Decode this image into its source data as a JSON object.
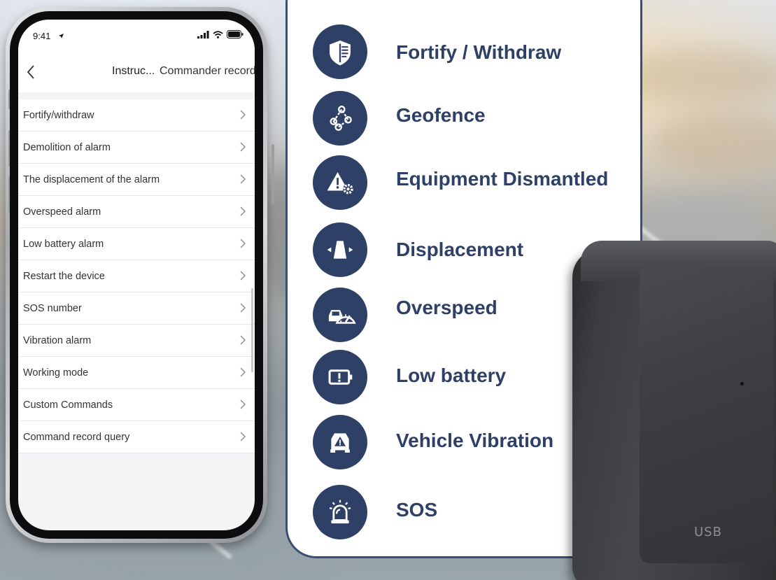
{
  "phone": {
    "status_time": "9:41",
    "title": "Instruc...",
    "right_link": "Commander record",
    "menu_items": [
      "Fortify/withdraw",
      "Demolition of alarm",
      "The displacement of the alarm",
      "Overspeed alarm",
      "Low battery alarm",
      "Restart the device",
      "SOS number",
      "Vibration alarm",
      "Working mode",
      "Custom Commands",
      "Command record query"
    ]
  },
  "features": [
    {
      "icon": "shield-icon",
      "label": "Fortify / Withdraw"
    },
    {
      "icon": "geofence-icon",
      "label": "Geofence"
    },
    {
      "icon": "warning-gear-icon",
      "label": "Equipment Dismantled"
    },
    {
      "icon": "displacement-icon",
      "label": "Displacement"
    },
    {
      "icon": "speedometer-icon",
      "label": "Overspeed"
    },
    {
      "icon": "battery-icon",
      "label": "Low battery"
    },
    {
      "icon": "car-warning-icon",
      "label": "Vehicle Vibration"
    },
    {
      "icon": "siren-icon",
      "label": "SOS"
    }
  ],
  "device": {
    "port_label": "USB"
  },
  "colors": {
    "accent": "#2e4066",
    "card_border": "#3b4f73"
  }
}
